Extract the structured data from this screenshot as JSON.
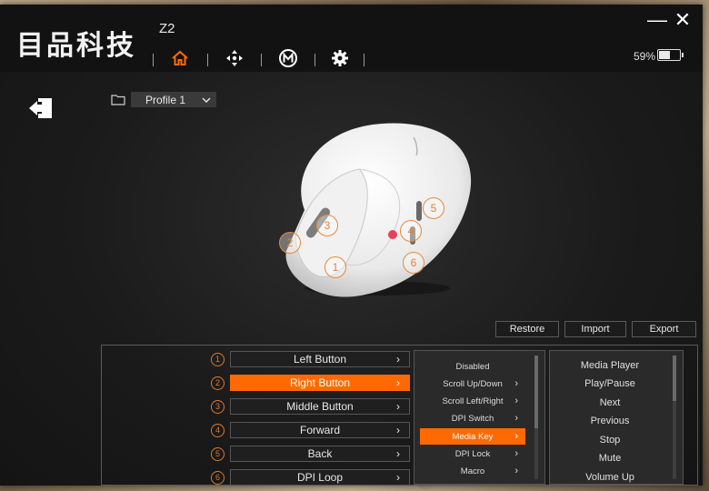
{
  "app": {
    "brand": "目品科技",
    "model": "Z2"
  },
  "battery": {
    "percent_text": "59%",
    "level": 0.59
  },
  "window_controls": {
    "minimize": "—",
    "close": "✕"
  },
  "nav": {
    "icons": [
      "home-icon",
      "move-arrows-icon",
      "macro-m-icon",
      "gear-icon"
    ],
    "active": "home-icon",
    "accent_color": "#ff6a00"
  },
  "profile": {
    "selected": "Profile 1"
  },
  "callouts": [
    "1",
    "2",
    "3",
    "4",
    "5",
    "6"
  ],
  "actions": {
    "restore": "Restore",
    "import": "Import",
    "export": "Export"
  },
  "buttons": [
    {
      "num": "1",
      "label": "Left Button"
    },
    {
      "num": "2",
      "label": "Right Button",
      "active": true
    },
    {
      "num": "3",
      "label": "Middle Button"
    },
    {
      "num": "4",
      "label": "Forward"
    },
    {
      "num": "5",
      "label": "Back"
    },
    {
      "num": "6",
      "label": "DPI Loop"
    }
  ],
  "function_menu": [
    {
      "label": "Disabled"
    },
    {
      "label": "Scroll Up/Down"
    },
    {
      "label": "Scroll Left/Right"
    },
    {
      "label": "DPI Switch"
    },
    {
      "label": "Media Key",
      "active": true
    },
    {
      "label": "DPI Lock"
    },
    {
      "label": "Macro"
    }
  ],
  "media_menu": [
    "Media Player",
    "Play/Pause",
    "Next",
    "Previous",
    "Stop",
    "Mute",
    "Volume Up"
  ]
}
